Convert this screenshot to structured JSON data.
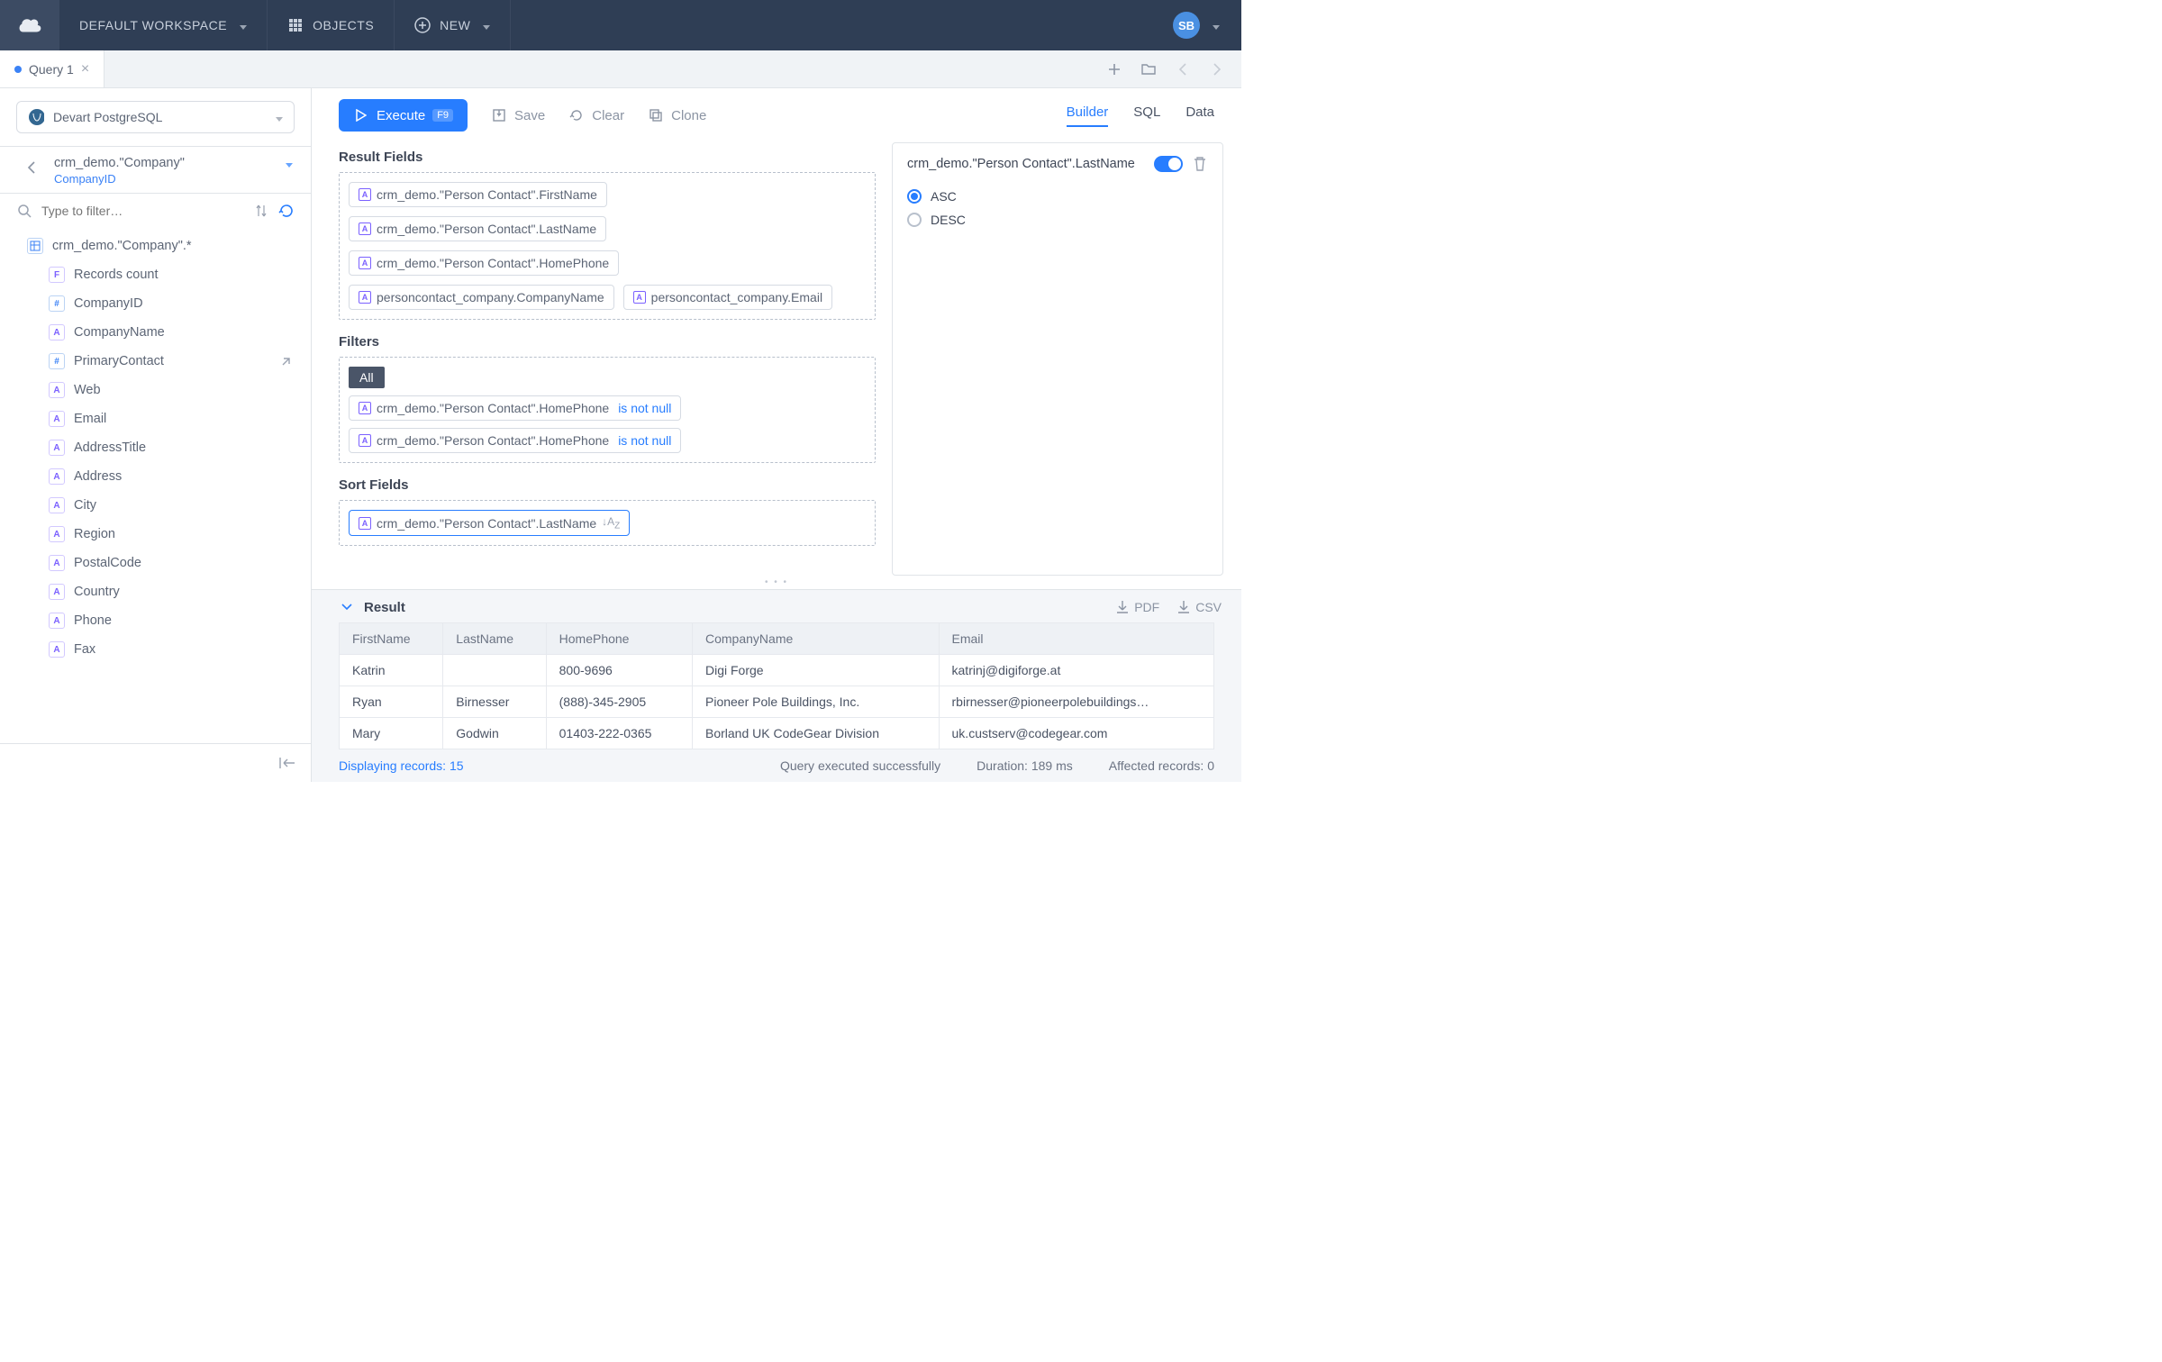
{
  "topbar": {
    "workspace": "DEFAULT WORKSPACE",
    "objects": "OBJECTS",
    "new": "NEW",
    "avatar": "SB"
  },
  "tab": {
    "name": "Query 1"
  },
  "connection": {
    "name": "Devart PostgreSQL"
  },
  "breadcrumb": {
    "main": "crm_demo.\"Company\"",
    "sub": "CompanyID"
  },
  "filter_placeholder": "Type to filter…",
  "tree": {
    "root": "crm_demo.\"Company\".*",
    "items": [
      {
        "t": "F",
        "label": "Records count",
        "ext": false
      },
      {
        "t": "#",
        "label": "CompanyID",
        "ext": false
      },
      {
        "t": "A",
        "label": "CompanyName",
        "ext": false
      },
      {
        "t": "#",
        "label": "PrimaryContact",
        "ext": true
      },
      {
        "t": "A",
        "label": "Web",
        "ext": false
      },
      {
        "t": "A",
        "label": "Email",
        "ext": false
      },
      {
        "t": "A",
        "label": "AddressTitle",
        "ext": false
      },
      {
        "t": "A",
        "label": "Address",
        "ext": false
      },
      {
        "t": "A",
        "label": "City",
        "ext": false
      },
      {
        "t": "A",
        "label": "Region",
        "ext": false
      },
      {
        "t": "A",
        "label": "PostalCode",
        "ext": false
      },
      {
        "t": "A",
        "label": "Country",
        "ext": false
      },
      {
        "t": "A",
        "label": "Phone",
        "ext": false
      },
      {
        "t": "A",
        "label": "Fax",
        "ext": false
      }
    ]
  },
  "toolbar": {
    "execute": "Execute",
    "execute_key": "F9",
    "save": "Save",
    "clear": "Clear",
    "clone": "Clone"
  },
  "view_tabs": {
    "builder": "Builder",
    "sql": "SQL",
    "data": "Data"
  },
  "builder": {
    "result_fields_title": "Result Fields",
    "result_fields": [
      "crm_demo.\"Person Contact\".FirstName",
      "crm_demo.\"Person Contact\".LastName",
      "crm_demo.\"Person Contact\".HomePhone",
      "personcontact_company.CompanyName",
      "personcontact_company.Email"
    ],
    "filters_title": "Filters",
    "filter_mode": "All",
    "filters": [
      {
        "field": "crm_demo.\"Person Contact\".HomePhone",
        "op": "is not null"
      },
      {
        "field": "crm_demo.\"Person Contact\".HomePhone",
        "op": "is not null"
      }
    ],
    "sort_title": "Sort Fields",
    "sort_fields": [
      "crm_demo.\"Person Contact\".LastName"
    ]
  },
  "props": {
    "field": "crm_demo.\"Person Contact\".LastName",
    "asc": "ASC",
    "desc": "DESC"
  },
  "result": {
    "title": "Result",
    "export_pdf": "PDF",
    "export_csv": "CSV",
    "headers": [
      "FirstName",
      "LastName",
      "HomePhone",
      "CompanyName",
      "Email"
    ],
    "rows": [
      [
        "Katrin",
        "",
        "800-9696",
        "Digi Forge",
        "katrinj@digiforge.at"
      ],
      [
        "Ryan",
        "Birnesser",
        "(888)-345-2905",
        "Pioneer Pole Buildings, Inc.",
        "rbirnesser@pioneerpolebuildings…"
      ],
      [
        "Mary",
        "Godwin",
        "01403-222-0365",
        "Borland UK CodeGear Division",
        "uk.custserv@codegear.com"
      ]
    ]
  },
  "status": {
    "displaying": "Displaying records: 15",
    "exec": "Query executed successfully",
    "duration": "Duration: 189 ms",
    "affected": "Affected records: 0"
  }
}
